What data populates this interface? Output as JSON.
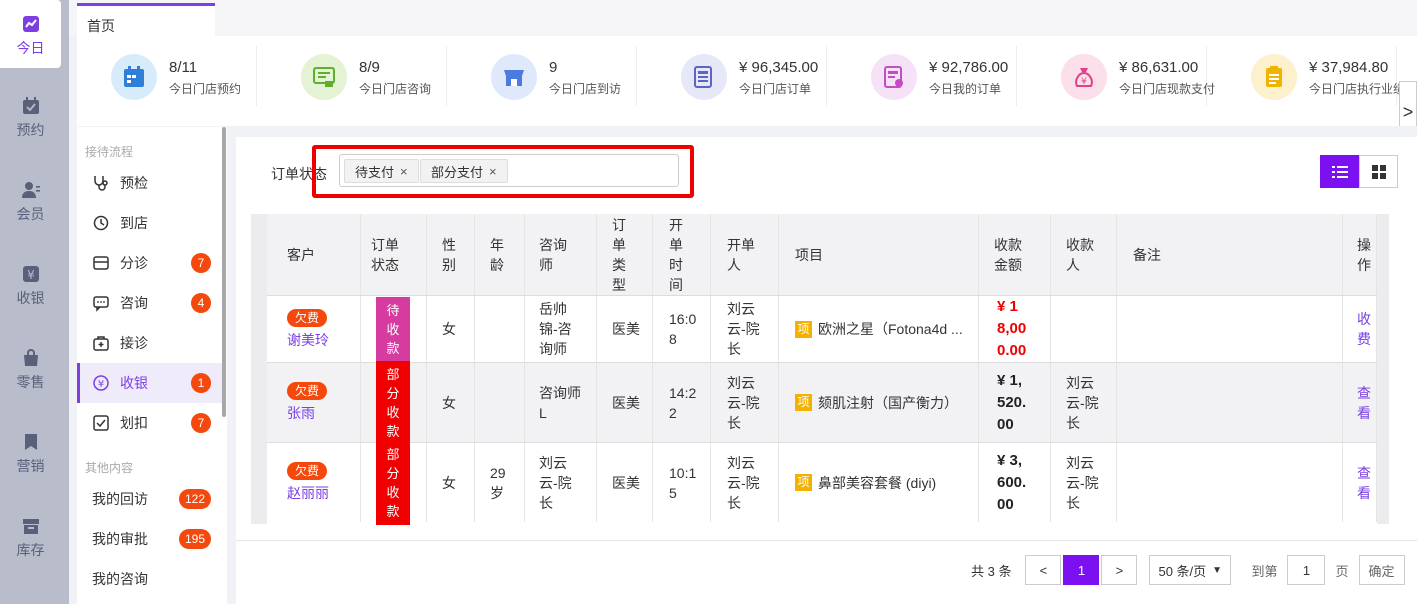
{
  "nav": {
    "items": [
      {
        "label": "今日",
        "icon": "chart-icon"
      },
      {
        "label": "预约",
        "icon": "calendar-icon"
      },
      {
        "label": "会员",
        "icon": "member-icon"
      },
      {
        "label": "收银",
        "icon": "yen-icon"
      },
      {
        "label": "零售",
        "icon": "bag-icon"
      },
      {
        "label": "营销",
        "icon": "bookmark-icon"
      },
      {
        "label": "库存",
        "icon": "box-icon"
      }
    ]
  },
  "tabs": {
    "home": "首页"
  },
  "stats": [
    {
      "value": "8/11",
      "label": "今日门店预约",
      "color": "#d6ecfb",
      "icon": "calendar-icon"
    },
    {
      "value": "8/9",
      "label": "今日门店咨询",
      "color": "#e4f3d4",
      "icon": "consult-icon"
    },
    {
      "value": "9",
      "label": "今日门店到访",
      "color": "#e0e8fb",
      "icon": "store-icon"
    },
    {
      "value": "¥ 96,345.00",
      "label": "今日门店订单",
      "color": "#e6e8f8",
      "icon": "news-icon"
    },
    {
      "value": "¥ 92,786.00",
      "label": "今日我的订单",
      "color": "#f6e2f6",
      "icon": "order-icon"
    },
    {
      "value": "¥ 86,631.00",
      "label": "今日门店现款支付",
      "color": "#fbe0ec",
      "icon": "money-bag-icon"
    },
    {
      "value": "¥ 37,984.80",
      "label": "今日门店执行业绩",
      "color": "#fdf0cc",
      "icon": "clipboard-icon"
    }
  ],
  "sidebar": {
    "section1": "接待流程",
    "section2": "其他内容",
    "items": [
      {
        "label": "预检",
        "badge": ""
      },
      {
        "label": "到店",
        "badge": ""
      },
      {
        "label": "分诊",
        "badge": "7"
      },
      {
        "label": "咨询",
        "badge": "4"
      },
      {
        "label": "接诊",
        "badge": ""
      },
      {
        "label": "收银",
        "badge": "1"
      },
      {
        "label": "划扣",
        "badge": "7"
      }
    ],
    "others": [
      {
        "label": "我的回访",
        "badge": "122"
      },
      {
        "label": "我的审批",
        "badge": "195"
      },
      {
        "label": "我的咨询",
        "badge": ""
      }
    ]
  },
  "filter": {
    "label": "订单状态",
    "chips": [
      "待支付",
      "部分支付"
    ]
  },
  "table": {
    "headers": [
      "客户",
      "订单\n状态",
      "性\n别",
      "年\n龄",
      "咨询\n师",
      "订\n单\n类\n型",
      "开\n单\n时\n间",
      "开单\n人",
      "项目",
      "收款\n金额",
      "收款\n人",
      "备注",
      "操\n作"
    ],
    "rows": [
      {
        "tag": "欠费",
        "name": "谢美玲",
        "status": "待\n收\n款",
        "status_color": "#d63ba0",
        "gender": "女",
        "age": "",
        "consultant": "岳帅\n锦-咨\n询师",
        "type": "医美",
        "time": "16:0\n8",
        "opener": "刘云\n云-院\n长",
        "project": "欧洲之星（Fotona4d ...",
        "amount": "¥ 1\n8,00\n0.00",
        "amount_red": true,
        "payee": "",
        "note": "",
        "action": "收\n费"
      },
      {
        "tag": "欠费",
        "name": "张雨",
        "status": "部\n分\n收\n款",
        "status_color": "#f00000",
        "gender": "女",
        "age": "",
        "consultant": "咨询师\nL",
        "type": "医美",
        "time": "14:2\n2",
        "opener": "刘云\n云-院\n长",
        "project": "颏肌注射（国产衡力）",
        "amount": "¥ 1,\n520.\n00",
        "amount_red": false,
        "payee": "刘云\n云-院\n长",
        "note": "",
        "action": "查\n看"
      },
      {
        "tag": "欠费",
        "name": "赵丽丽",
        "status": "部\n分\n收\n款",
        "status_color": "#f00000",
        "gender": "女",
        "age": "29\n岁",
        "consultant": "刘云\n云-院\n长",
        "type": "医美",
        "time": "10:1\n5",
        "opener": "刘云\n云-院\n长",
        "project": "鼻部美容套餐  (diyi)",
        "amount": "¥ 3,\n600.\n00",
        "amount_red": false,
        "payee": "刘云\n云-院\n长",
        "note": "",
        "action": "查\n看"
      }
    ],
    "project_tag": "项"
  },
  "pager": {
    "total": "共 3 条",
    "prev": "<",
    "current": "1",
    "next": ">",
    "page_size": "50 条/页",
    "goto": "到第",
    "goto_value": "1",
    "page_unit": "页",
    "confirm": "确定"
  },
  "colors": {
    "accent": "#7b11f0",
    "badge": "#f5480c",
    "highlight": "#e00000"
  }
}
